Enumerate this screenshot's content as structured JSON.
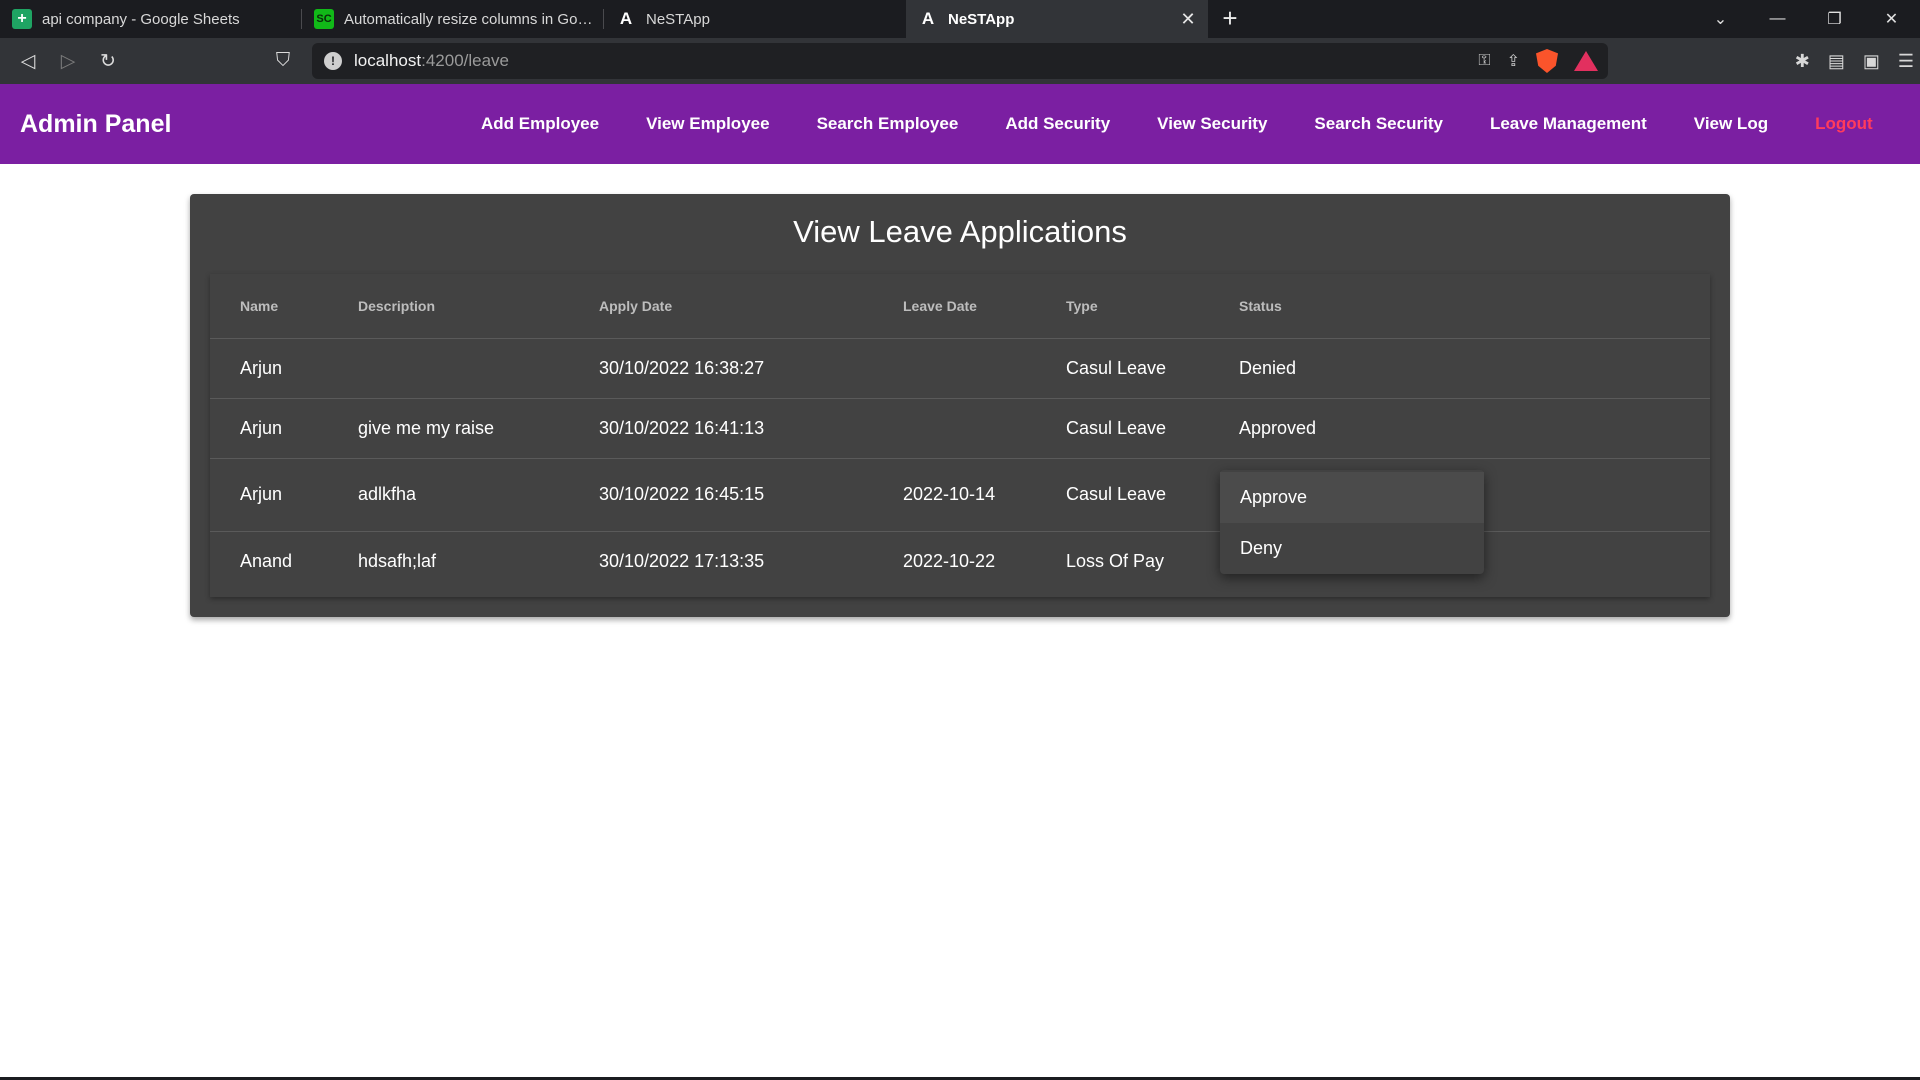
{
  "browser": {
    "tabs": [
      {
        "title": "api company - Google Sheets",
        "favicon": "google-sheets-icon",
        "favicon_text": "+",
        "active": false
      },
      {
        "title": "Automatically resize columns in Goog",
        "favicon": "sc-site-icon",
        "favicon_text": "SC",
        "active": false
      },
      {
        "title": "NeSTApp",
        "favicon": "angular-icon",
        "favicon_text": "A",
        "active": false
      },
      {
        "title": "NeSTApp",
        "favicon": "angular-icon",
        "favicon_text": "A",
        "active": true
      }
    ],
    "new_tab_label": "+",
    "url_host": "localhost",
    "url_path": ":4200/leave"
  },
  "app": {
    "brand": "Admin Panel",
    "nav": [
      "Add Employee",
      "View Employee",
      "Search Employee",
      "Add Security",
      "View Security",
      "Search Security",
      "Leave Management",
      "View Log"
    ],
    "logout": "Logout",
    "colors": {
      "appbar": "#7b1fa2",
      "logout": "#ff3b5c",
      "card": "#424242"
    }
  },
  "leave": {
    "title": "View Leave Applications",
    "columns": [
      "Name",
      "Description",
      "Apply Date",
      "Leave Date",
      "Type",
      "Status"
    ],
    "rows": [
      {
        "name": "Arjun",
        "description": "",
        "apply_date": "30/10/2022 16:38:27",
        "leave_date": "",
        "type": "Casul Leave",
        "status": "Denied"
      },
      {
        "name": "Arjun",
        "description": "give me my raise",
        "apply_date": "30/10/2022 16:41:13",
        "leave_date": "",
        "type": "Casul Leave",
        "status": "Approved"
      },
      {
        "name": "Arjun",
        "description": "adlkfha",
        "apply_date": "30/10/2022 16:45:15",
        "leave_date": "2022-10-14",
        "type": "Casul Leave",
        "status": ""
      },
      {
        "name": "Anand",
        "description": "hdsafh;laf",
        "apply_date": "30/10/2022 17:13:35",
        "leave_date": "2022-10-22",
        "type": "Loss Of Pay",
        "status": ""
      }
    ],
    "status_menu": {
      "options": [
        "Approve",
        "Deny"
      ],
      "focused": "Approve"
    }
  }
}
